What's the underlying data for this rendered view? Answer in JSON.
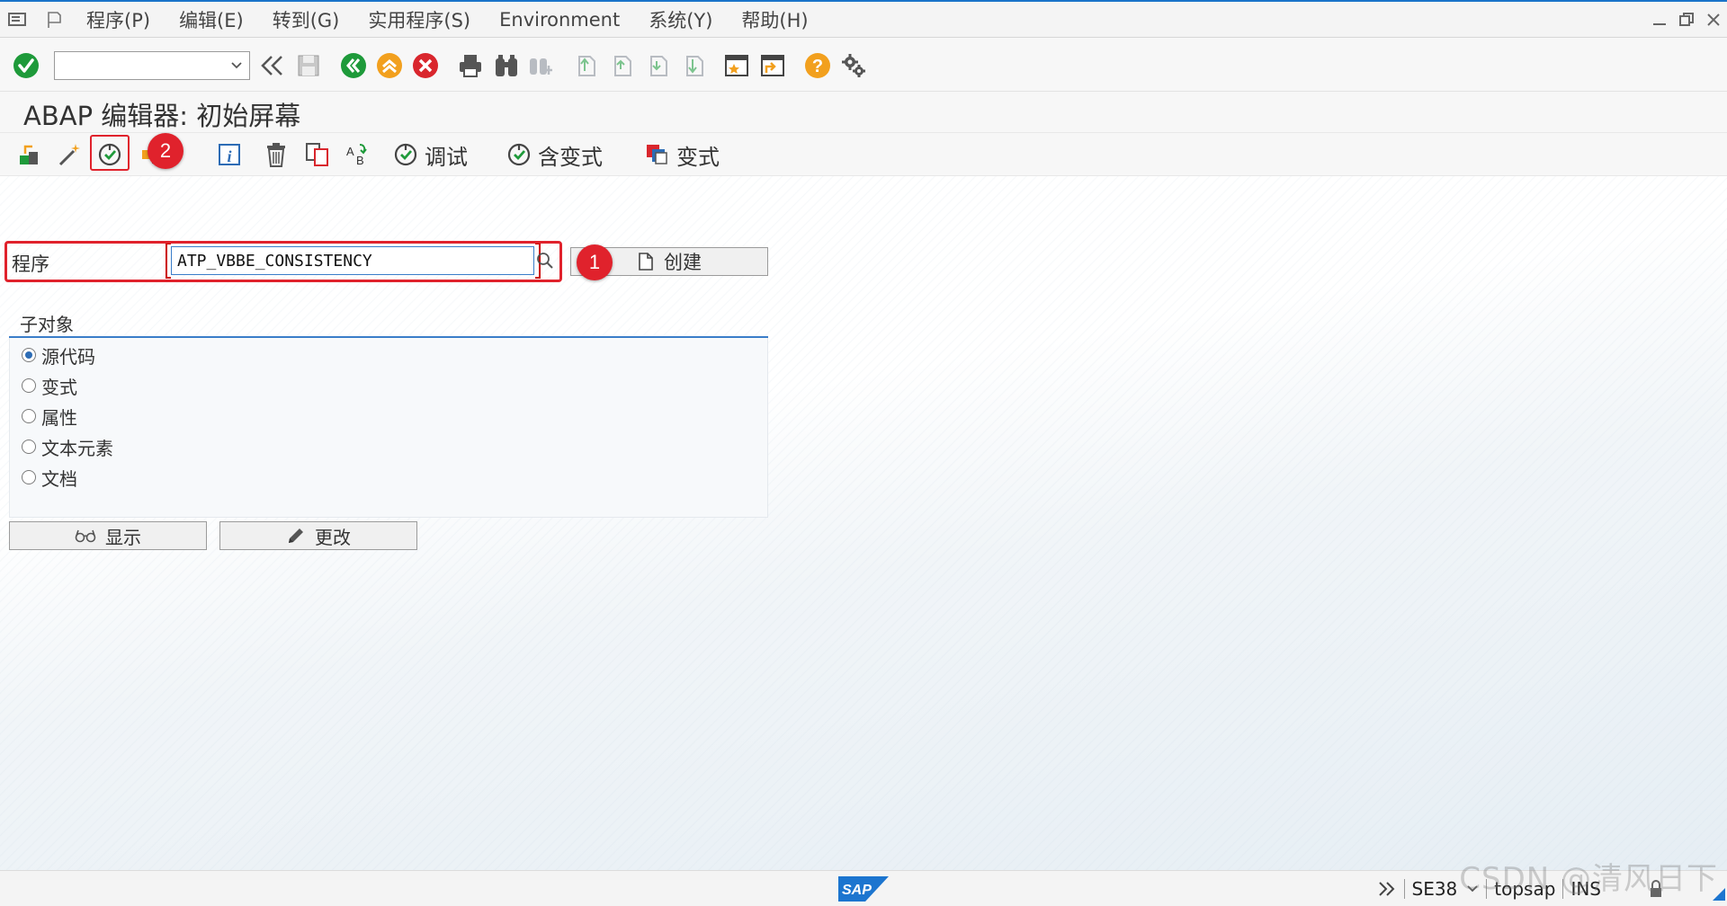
{
  "menubar": {
    "items": [
      "程序(P)",
      "编辑(E)",
      "转到(G)",
      "实用程序(S)",
      "Environment",
      "系统(Y)",
      "帮助(H)"
    ]
  },
  "toolbar": {
    "command_value": "",
    "icons": [
      "enter-check",
      "back-double",
      "save",
      "back",
      "exit",
      "cancel",
      "print",
      "find",
      "find-next",
      "first-page",
      "prev-page",
      "next-page",
      "last-page",
      "create-session",
      "shortcut",
      "help",
      "customize-layout"
    ]
  },
  "title": "ABAP 编辑器: 初始屏幕",
  "apptoolbar": {
    "debug_label": "调试",
    "with_variant_label": "含变式",
    "variant_label": "变式"
  },
  "form": {
    "program_label": "程序",
    "program_value": "ATP_VBBE_CONSISTENCY",
    "create_label": "创建",
    "subobjects_title": "子对象",
    "subobjects": [
      {
        "label": "源代码",
        "selected": true
      },
      {
        "label": "变式",
        "selected": false
      },
      {
        "label": "属性",
        "selected": false
      },
      {
        "label": "文本元素",
        "selected": false
      },
      {
        "label": "文档",
        "selected": false
      }
    ],
    "display_label": "显示",
    "change_label": "更改"
  },
  "annotations": {
    "badge1": "1",
    "badge2": "2"
  },
  "statusbar": {
    "transaction": "SE38",
    "user": "topsap",
    "mode": "INS"
  },
  "watermark": "CSDN @清风日下",
  "colors": {
    "accent": "#1a73c9",
    "annotation_red": "#e0222c",
    "ok_green": "#1e9a3a",
    "warn_orange": "#f2a01e"
  }
}
